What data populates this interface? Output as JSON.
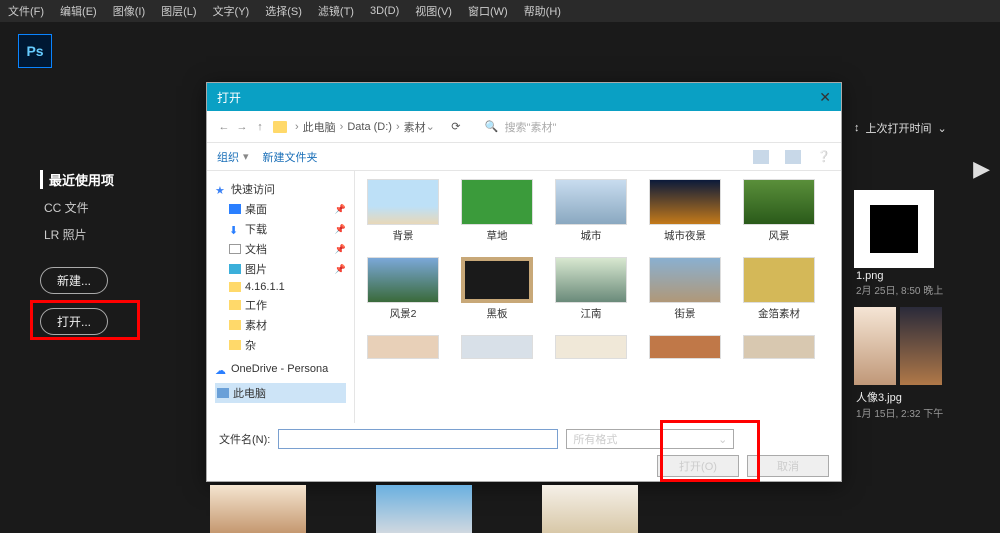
{
  "menubar": [
    "文件(F)",
    "编辑(E)",
    "图像(I)",
    "图层(L)",
    "文字(Y)",
    "选择(S)",
    "滤镜(T)",
    "3D(D)",
    "视图(V)",
    "窗口(W)",
    "帮助(H)"
  ],
  "logo": "Ps",
  "sidebar": {
    "heading": "最近使用项",
    "links": [
      "CC 文件",
      "LR 照片"
    ],
    "btn_new": "新建...",
    "btn_open": "打开..."
  },
  "dialog": {
    "title": "打开",
    "breadcrumb": [
      "此电脑",
      "Data (D:)",
      "素材"
    ],
    "search_placeholder": "搜索\"素材\"",
    "toolbar": {
      "organize": "组织",
      "newfolder": "新建文件夹"
    },
    "tree": {
      "quick": "快速访问",
      "items": [
        "桌面",
        "下载",
        "文档",
        "图片",
        "4.16.1.1",
        "工作",
        "素材",
        "杂"
      ],
      "onedrive": "OneDrive - Persona",
      "pc": "此电脑"
    },
    "grid": {
      "row1": [
        "背景",
        "草地",
        "城市",
        "城市夜景",
        "风景"
      ],
      "row2": [
        "风景2",
        "黑板",
        "江南",
        "街景",
        "金箔素材"
      ]
    },
    "filename_label": "文件名(N):",
    "format": "所有格式",
    "btn_open": "打开(O)",
    "btn_cancel": "取消"
  },
  "right": {
    "sort": "上次打开时间",
    "i1_name": "1.png",
    "i1_date": "2月 25日, 8:50 晚上",
    "i2_name": "人像3.jpg",
    "i2_date": "1月 15日, 2:32 下午"
  }
}
